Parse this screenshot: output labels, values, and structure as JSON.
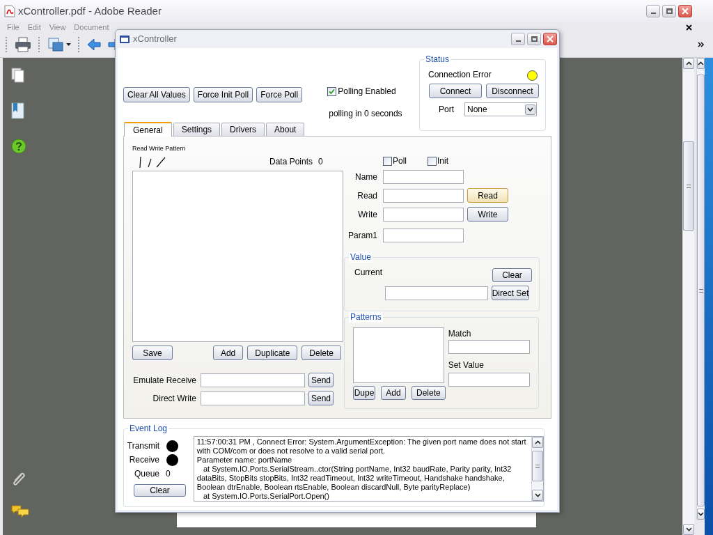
{
  "reader": {
    "title": "xController.pdf - Adobe Reader",
    "menu": [
      "File",
      "Edit",
      "View",
      "Document"
    ]
  },
  "window": {
    "title": "xController"
  },
  "actions": [
    "Clear All Values",
    "Force Init Poll",
    "Force Poll"
  ],
  "polling": {
    "label": "Polling Enabled",
    "checked": true,
    "countdown": "polling in 0 seconds"
  },
  "status": {
    "title": "Status",
    "message": "Connection Error",
    "color": "#ffff00",
    "buttons": [
      "Connect",
      "Disconnect"
    ],
    "port_label": "Port",
    "port_value": "None"
  },
  "tabs": [
    {
      "label": "General",
      "selected": true
    },
    {
      "label": "Settings",
      "selected": false
    },
    {
      "label": "Drivers",
      "selected": false
    },
    {
      "label": "About",
      "selected": false
    }
  ],
  "general": {
    "pattern_label": "Read Write Pattern",
    "data_points_label": "Data Points",
    "data_points": "0",
    "list_buttons": [
      {
        "kind": "save",
        "label": "Save"
      },
      {
        "kind": "edit",
        "label": "Add"
      },
      {
        "kind": "edit",
        "label": "Duplicate"
      },
      {
        "kind": "edit",
        "label": "Delete"
      }
    ],
    "send_rows": [
      {
        "label": "Emulate Receive",
        "button": "Send"
      },
      {
        "label": "Direct Write",
        "button": "Send"
      }
    ],
    "options": [
      {
        "label": "Poll",
        "checked": false
      },
      {
        "label": "Init",
        "checked": false
      }
    ],
    "fields": [
      {
        "label": "Name"
      },
      {
        "label": "Read",
        "button": "Read",
        "highlighted": true
      },
      {
        "label": "Write",
        "button": "Write",
        "highlighted": false
      },
      {
        "label": "Param1"
      }
    ],
    "value": {
      "title": "Value",
      "current_label": "Current",
      "clear": "Clear",
      "direct_set": "Direct Set"
    },
    "patterns": {
      "title": "Patterns",
      "match_label": "Match",
      "set_value_label": "Set Value",
      "buttons": [
        "Dupe",
        "Add",
        "Delete"
      ]
    }
  },
  "event_log": {
    "title": "Event Log",
    "indicators": [
      {
        "label": "Transmit",
        "color": "#000000"
      },
      {
        "label": "Receive",
        "color": "#000000"
      }
    ],
    "queue_label": "Queue",
    "queue": "0",
    "clear": "Clear",
    "lines": [
      "11:57:00:31 PM , Connect Error: System.ArgumentException: The given port name does not start",
      "with COM/com or does not resolve to a valid serial port.",
      "Parameter name: portName",
      "   at System.IO.Ports.SerialStream..ctor(String portName, Int32 baudRate, Parity parity, Int32",
      "dataBits, StopBits stopBits, Int32 readTimeout, Int32 writeTimeout, Handshake handshake,",
      "Boolean dtrEnable, Boolean rtsEnable, Boolean discardNull, Byte parityReplace)",
      "   at System.IO.Ports.SerialPort.Open()"
    ]
  }
}
